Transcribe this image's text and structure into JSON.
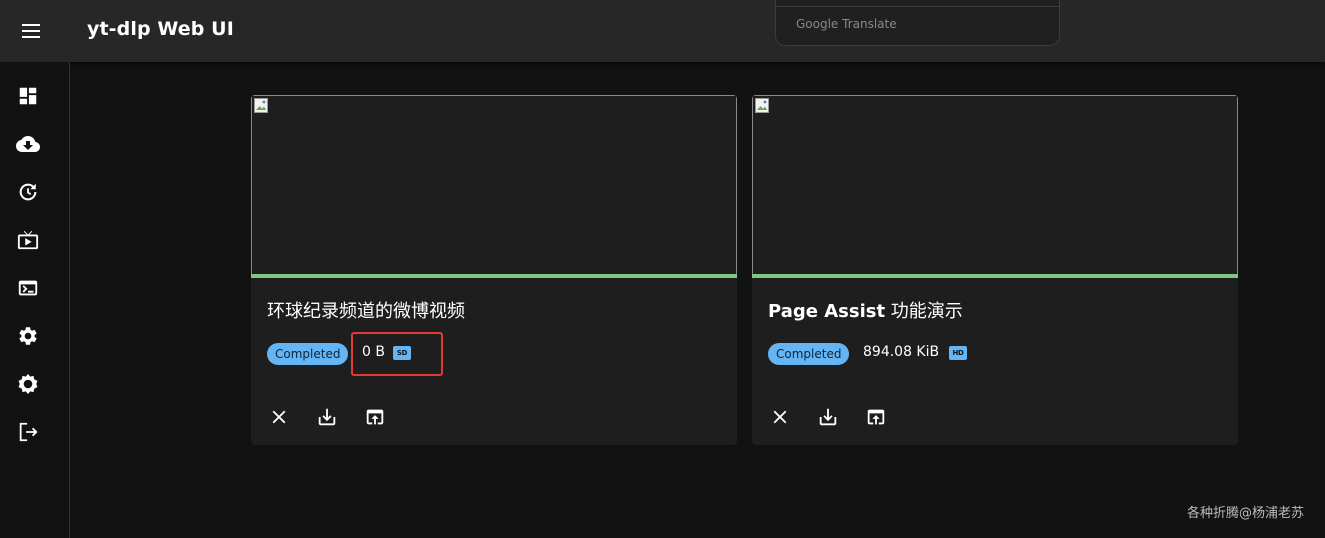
{
  "app": {
    "title": "yt-dlp Web UI"
  },
  "overlay": {
    "google_translate": "Google Translate"
  },
  "sidebar": {
    "items": [
      {
        "name": "dashboard",
        "icon": "dashboard-icon"
      },
      {
        "name": "download",
        "icon": "cloud-download-icon"
      },
      {
        "name": "history",
        "icon": "history-icon"
      },
      {
        "name": "live",
        "icon": "live-tv-icon"
      },
      {
        "name": "terminal",
        "icon": "terminal-icon"
      },
      {
        "name": "settings",
        "icon": "gear-icon"
      },
      {
        "name": "archive",
        "icon": "settings-outline-icon"
      },
      {
        "name": "logout",
        "icon": "logout-icon"
      }
    ]
  },
  "cards": [
    {
      "title": "环球纪录频道的微博视频",
      "status": "Completed",
      "size": "0 B",
      "quality": "SD",
      "progress": 1.0
    },
    {
      "title_en": "Page Assist",
      "title_zh": "功能演示",
      "status": "Completed",
      "size": "894.08 KiB",
      "quality": "HD",
      "progress": 1.0
    }
  ],
  "colors": {
    "accent": "#64b5f6",
    "progress": "#81c784",
    "highlight": "#e53935",
    "background": "#121212",
    "card": "#1e1e1e"
  },
  "watermark": "各种折腾@杨浦老苏"
}
